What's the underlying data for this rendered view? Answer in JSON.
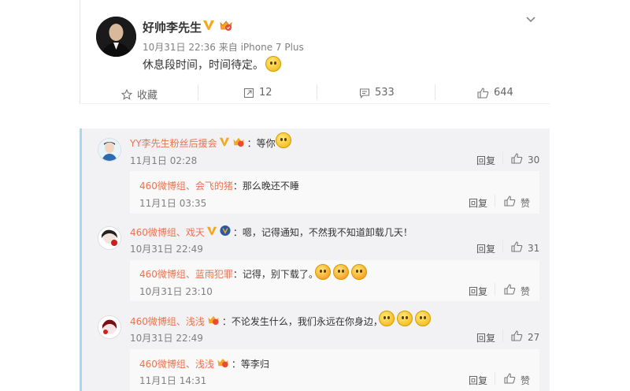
{
  "post": {
    "author": "好帅李先生",
    "meta": "10月31日 22:36 来自 iPhone 7 Plus",
    "text": "休息段时间，时间待定。",
    "actions": {
      "favorite": "收藏",
      "repost": "12",
      "comment": "533",
      "like": "644"
    }
  },
  "comments": [
    {
      "name": "YY李先生粉丝后援会",
      "text": "：等你",
      "time": "11月1日 02:28",
      "reply_label": "回复",
      "likes": "30",
      "sub": {
        "name": "460微博组、会飞的猪",
        "text": "：那么晚还不睡",
        "time": "11月1日 03:35",
        "reply_label": "回复",
        "like_label": "赞"
      }
    },
    {
      "name": "460微博组、戏天",
      "text": "：嗯，记得通知，不然我不知道卸载几天！",
      "time": "10月31日 22:49",
      "reply_label": "回复",
      "likes": "31",
      "sub": {
        "name": "460微博组、蓝雨犯罪",
        "text": "：记得，别下载了。",
        "time": "10月31日 23:10",
        "reply_label": "回复",
        "like_label": "赞"
      }
    },
    {
      "name": "460微博组、浅浅",
      "text": "：不论发生什么，我们永远在你身边，",
      "time": "10月31日 22:49",
      "reply_label": "回复",
      "likes": "27",
      "sub": {
        "name": "460微博组、浅浅",
        "text": "：等李归",
        "time": "11月1日 14:31",
        "reply_label": "回复",
        "like_label": "赞"
      }
    }
  ],
  "colors": {
    "name": "#eb7350",
    "accent_border": "#a8d8f0",
    "vip": "#f5a623"
  }
}
